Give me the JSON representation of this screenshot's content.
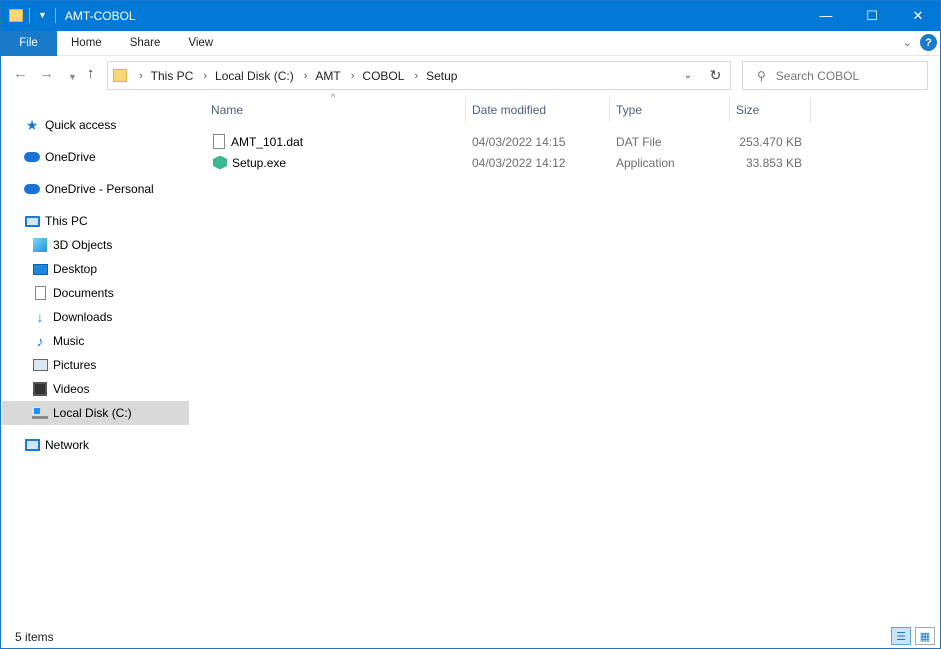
{
  "window": {
    "title": "AMT-COBOL"
  },
  "ribbon": {
    "tabs": [
      "File",
      "Home",
      "Share",
      "View"
    ],
    "help_label": "?"
  },
  "address": {
    "crumbs": [
      "This PC",
      "Local Disk (C:)",
      "AMT",
      "COBOL",
      "Setup"
    ]
  },
  "search": {
    "placeholder": "Search COBOL"
  },
  "sidebar": {
    "items": [
      {
        "label": "Quick access",
        "icon": "star-icon"
      },
      {
        "label": "OneDrive",
        "icon": "cloud-icon"
      },
      {
        "label": "OneDrive - Personal",
        "icon": "cloud-icon"
      },
      {
        "label": "This PC",
        "icon": "computer-icon"
      },
      {
        "label": "3D Objects",
        "icon": "3d-objects-icon"
      },
      {
        "label": "Desktop",
        "icon": "desktop-icon"
      },
      {
        "label": "Documents",
        "icon": "documents-icon"
      },
      {
        "label": "Downloads",
        "icon": "download-arrow-icon"
      },
      {
        "label": "Music",
        "icon": "music-note-icon"
      },
      {
        "label": "Pictures",
        "icon": "pictures-icon"
      },
      {
        "label": "Videos",
        "icon": "film-icon"
      },
      {
        "label": "Local Disk (C:)",
        "icon": "drive-icon",
        "selected": true
      },
      {
        "label": "Network",
        "icon": "network-icon"
      }
    ]
  },
  "columns": [
    "Name",
    "Date modified",
    "Type",
    "Size"
  ],
  "files": [
    {
      "name": "AMT_101.dat",
      "date": "04/03/2022 14:15",
      "type": "DAT File",
      "size": "253.470 KB",
      "icon": "document-icon"
    },
    {
      "name": "Setup.exe",
      "date": "04/03/2022 14:12",
      "type": "Application",
      "size": "33.853 KB",
      "icon": "installer-icon"
    }
  ],
  "status": {
    "count": "5 items"
  },
  "colors": {
    "accent": "#0078d7",
    "selected_bg": "#d9d9d9",
    "header_text": "#4c607a"
  }
}
